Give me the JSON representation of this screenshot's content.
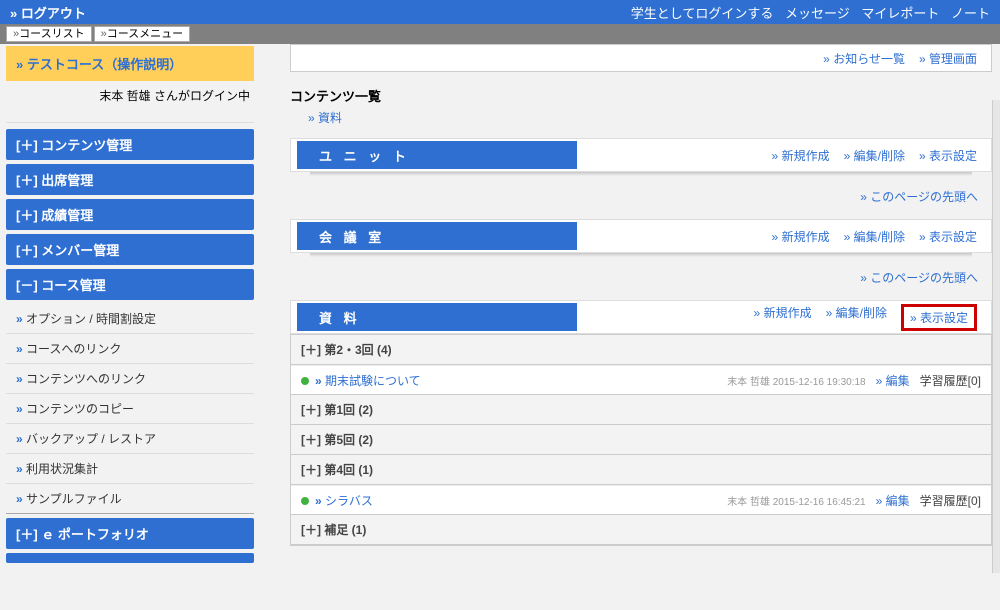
{
  "top": {
    "logout": "ログアウト",
    "login_as_student": "学生としてログインする",
    "messages": "メッセージ",
    "myreport": "マイレポート",
    "note": "ノート"
  },
  "breadcrumb": {
    "list": "コースリスト",
    "menu": "コースメニュー"
  },
  "course": {
    "title": "テストコース（操作説明）",
    "login_status": "末本  哲雄 さんがログイン中"
  },
  "nav": {
    "contents_mgmt": "[＋] コンテンツ管理",
    "attendance_mgmt": "[＋] 出席管理",
    "grade_mgmt": "[＋] 成績管理",
    "member_mgmt": "[＋] メンバー管理",
    "course_mgmt": "[－] コース管理",
    "eportfolio": "[＋] ｅ ポートフォリオ"
  },
  "course_sub": {
    "option": "オプション / 時間割設定",
    "course_link": "コースへのリンク",
    "contents_link": "コンテンツへのリンク",
    "contents_copy": "コンテンツのコピー",
    "backup": "バックアップ / レストア",
    "usage": "利用状況集計",
    "sample": "サンプルファイル"
  },
  "info": {
    "news": "お知らせ一覧",
    "admin": "管理画面"
  },
  "contents": {
    "title": "コンテンツ一覧",
    "link": "資料"
  },
  "unit": {
    "tab": "ユ ニ ッ ト"
  },
  "meeting": {
    "tab": "会 議 室"
  },
  "material": {
    "tab": "資 料"
  },
  "actions": {
    "new": "新規作成",
    "edit_delete": "編集/削除",
    "display": "表示設定"
  },
  "to_top": "このページの先頭へ",
  "rows": {
    "r1": "[＋] 第2・3回 (4)",
    "r1a_link": "期末試験について",
    "r1a_meta": "末本  哲雄  2015-12-16 19:30:18",
    "r2": "[＋] 第1回 (2)",
    "r3": "[＋] 第5回 (2)",
    "r4": "[＋] 第4回 (1)",
    "r4a_link": "シラバス",
    "r4a_meta": "末本  哲雄  2015-12-16 16:45:21",
    "r5": "[＋] 補足 (1)",
    "edit": "編集",
    "history": "学習履歴[0]"
  },
  "glyph": {
    "dchev": "»"
  }
}
